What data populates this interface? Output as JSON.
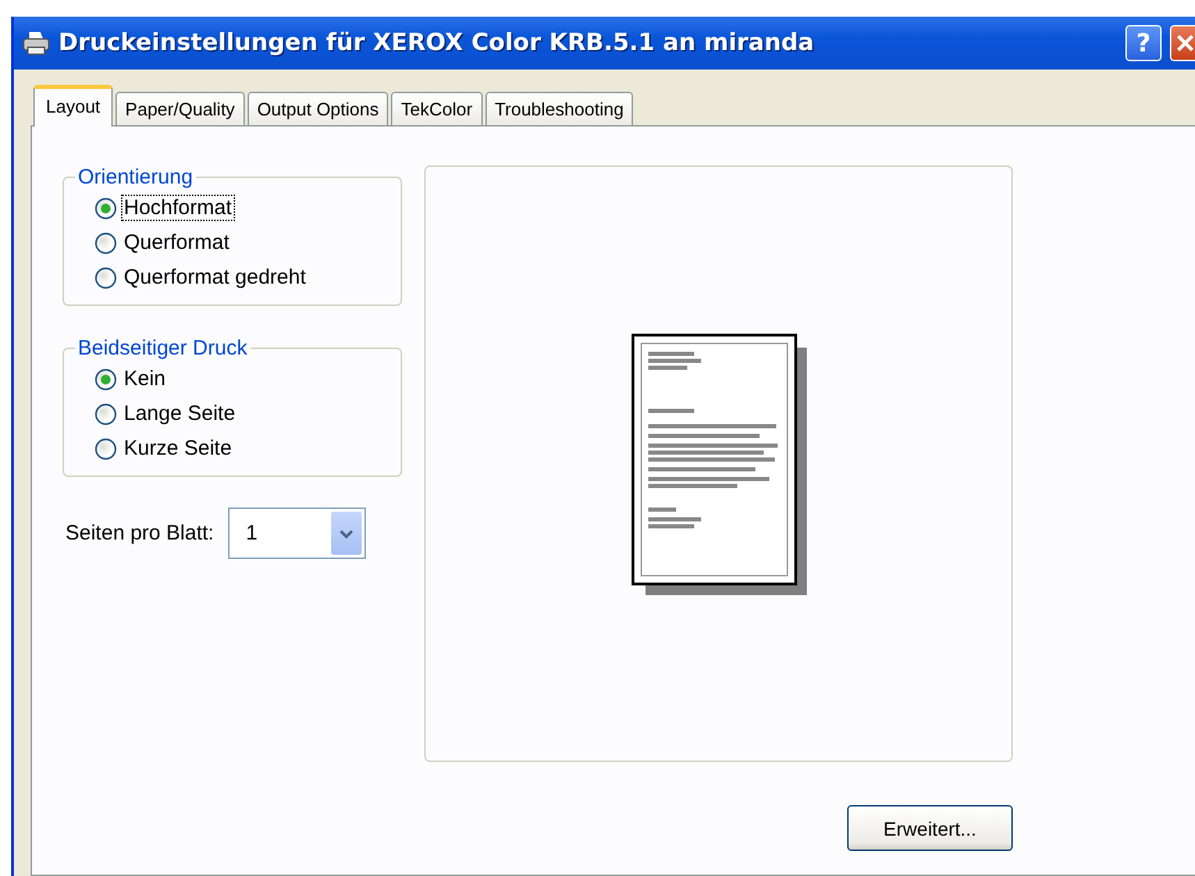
{
  "window": {
    "title": "Druckeinstellungen für XEROX Color KRB.5.1 an miranda",
    "help_button": "?"
  },
  "tabs": [
    {
      "label": "Layout",
      "selected": true
    },
    {
      "label": "Paper/Quality",
      "selected": false
    },
    {
      "label": "Output Options",
      "selected": false
    },
    {
      "label": "TekColor",
      "selected": false
    },
    {
      "label": "Troubleshooting",
      "selected": false
    }
  ],
  "groups": [
    {
      "title": "Orientierung",
      "options": [
        {
          "label": "Hochformat",
          "selected": true,
          "focused": true
        },
        {
          "label": "Querformat",
          "selected": false,
          "focused": false
        },
        {
          "label": "Querformat gedreht",
          "selected": false,
          "focused": false
        }
      ]
    },
    {
      "title": "Beidseitiger Druck",
      "options": [
        {
          "label": "Kein",
          "selected": true,
          "focused": false
        },
        {
          "label": "Lange Seite",
          "selected": false,
          "focused": false
        },
        {
          "label": "Kurze Seite",
          "selected": false,
          "focused": false
        }
      ]
    }
  ],
  "pages_per_sheet": {
    "label": "Seiten pro Blatt:",
    "value": "1"
  },
  "advanced_button": {
    "label": "Erweitert..."
  }
}
